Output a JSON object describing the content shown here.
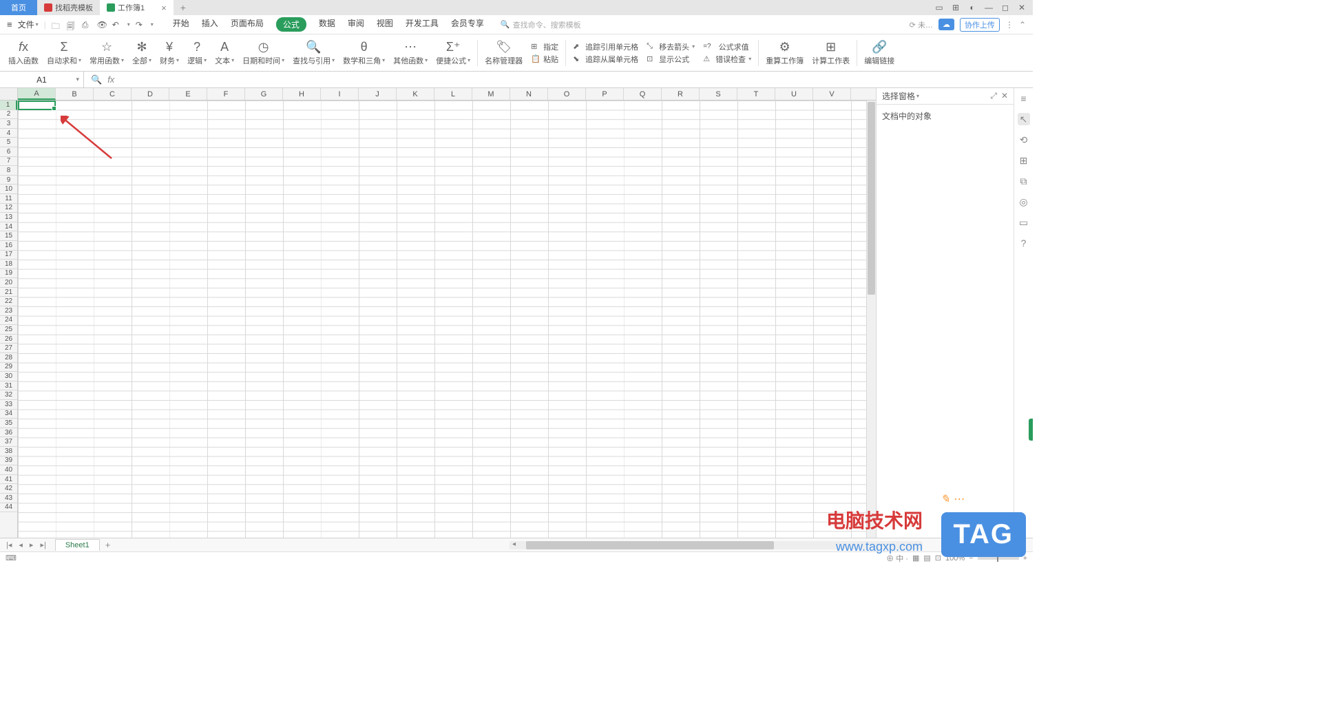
{
  "titlebar": {
    "home_tab": "首页",
    "doc_tab1": "找稻壳模板",
    "doc_tab2": "工作簿1",
    "close": "×",
    "add": "+"
  },
  "quickbar": {
    "file_label": "文件",
    "ribbon_tabs": [
      "开始",
      "插入",
      "页面布局",
      "公式",
      "数据",
      "审阅",
      "视图",
      "开发工具",
      "会员专享"
    ],
    "active_tab_index": 3,
    "search_placeholder": "查找命令、搜索模板",
    "unsynced": "未…",
    "upload_label": "协作上传"
  },
  "ribbon": {
    "insert_fn": "插入函数",
    "autosum": "自动求和",
    "common_fn": "常用函数",
    "all": "全部",
    "finance": "财务",
    "logic": "逻辑",
    "text": "文本",
    "datetime": "日期和时间",
    "lookup": "查找与引用",
    "math": "数学和三角",
    "other": "其他函数",
    "quick_formula": "便捷公式",
    "name_mgr": "名称管理器",
    "designate": "指定",
    "paste": "粘贴",
    "trace_precedents": "追踪引用单元格",
    "trace_dependents": "追踪从属单元格",
    "remove_arrows": "移去箭头",
    "show_formula": "显示公式",
    "eval_formula": "公式求值",
    "error_check": "错误检查",
    "recalc_book": "重算工作簿",
    "calc_sheet": "计算工作表",
    "edit_link": "编辑链接"
  },
  "formula_row": {
    "cell_ref": "A1",
    "fx": "fx"
  },
  "sheet": {
    "cols": [
      "A",
      "B",
      "C",
      "D",
      "E",
      "F",
      "G",
      "H",
      "I",
      "J",
      "K",
      "L",
      "M",
      "N",
      "O",
      "P",
      "Q",
      "R",
      "S",
      "T",
      "U",
      "V"
    ],
    "row_count": 44,
    "active_sheet": "Sheet1"
  },
  "side_panel": {
    "title": "选择窗格",
    "body_text": "文档中的对象"
  },
  "status": {
    "zoom": "100%"
  },
  "watermark": {
    "text1": "电脑技术网",
    "url": "www.tagxp.com",
    "badge": "TAG"
  }
}
